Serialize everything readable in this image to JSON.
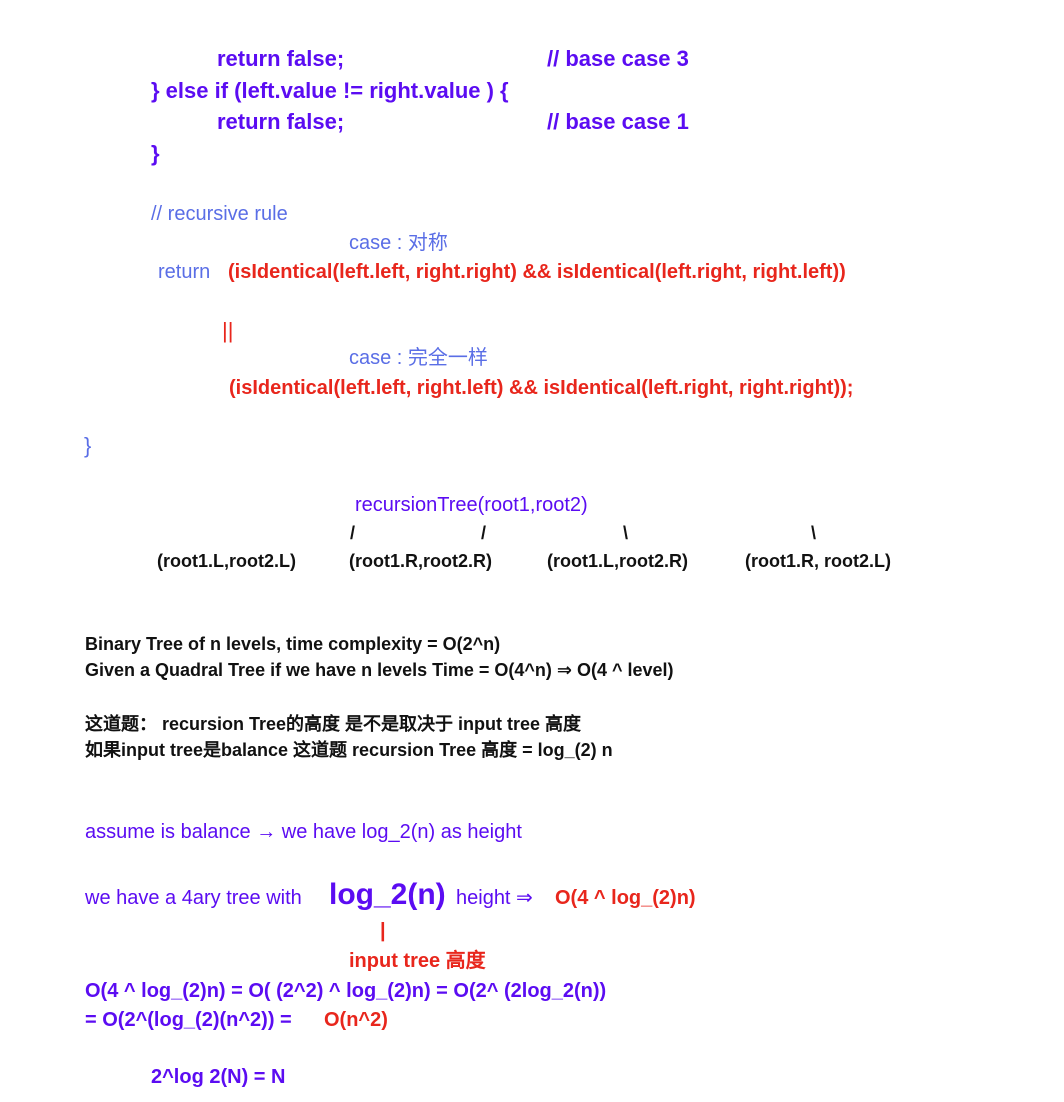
{
  "code": {
    "return_false_3": "return false;",
    "comment_base_case_3": "// base case  3",
    "else_if_line": "} else if (left.value != right.value ) {",
    "return_false_1": "return false;",
    "comment_base_case_1": "// base case  1",
    "close_brace": "}",
    "comment_recursive_rule": "// recursive rule",
    "case_symmetric": "case : 对称",
    "return_keyword": "return",
    "symmetric_expr": "(isIdentical(left.left, right.right) && isIdentical(left.right, right.left))",
    "or_operator": "||",
    "case_identical": "case :  完全一样",
    "identical_expr": "(isIdentical(left.left, right.left) && isIdentical(left.right, right.right));",
    "outer_close_brace": "}"
  },
  "recursion_tree": {
    "root": "recursionTree(root1,root2)",
    "branches": [
      "/",
      "/",
      "\\",
      "\\"
    ],
    "children": [
      "(root1.L,root2.L)",
      "(root1.R,root2.R)",
      "(root1.L,root2.R)",
      "(root1.R, root2.L)"
    ]
  },
  "complexity": {
    "line1": "Binary Tree of n levels, time complexity = O(2^n)",
    "line2": "Given a Quadral Tree if we have n levels Time = O(4^n) ⇒ O(4 ^ level)",
    "line3": "这道题：  recursion Tree的高度 是不是取决于 input tree 高度",
    "line4": "如果input tree是balance 这道题 recursion Tree 高度 = log_(2) n"
  },
  "analysis": {
    "assume": "assume is balance →  we have  log_2(n) as height",
    "fourary_prefix": "we have a 4ary tree with",
    "fourary_big": "log_2(n)",
    "fourary_suffix": "height ⇒",
    "fourary_result": "O(4 ^ log_(2)n)",
    "pointer": "|",
    "pointer_label": "input tree 高度",
    "derivation1": "O(4 ^ log_(2)n) = O( (2^2) ^ log_(2)n) = O(2^ (2log_2(n))",
    "derivation2_prefix": "= O(2^(log_(2)(n^2)) =",
    "derivation2_result": "O(n^2)",
    "identity": "2^log 2(N) = N"
  },
  "colors": {
    "purple": "#5b0cf2",
    "blue": "#5a6ee6",
    "red": "#e8261c",
    "black": "#111111"
  }
}
